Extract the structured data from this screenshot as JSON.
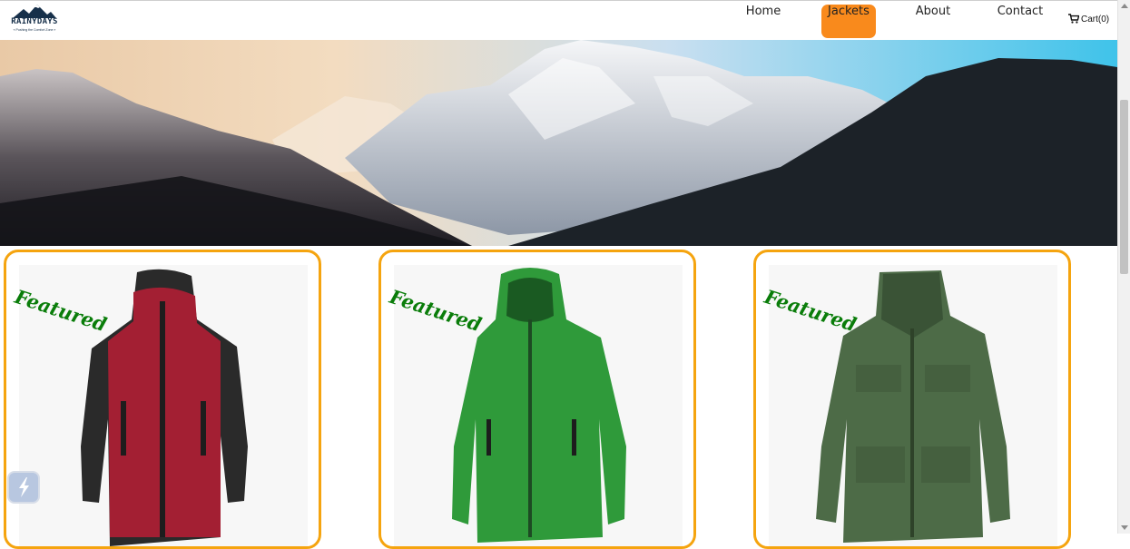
{
  "brand": {
    "name": "RAINYDAYS",
    "tagline": "« Pushing the Comfort Zone »"
  },
  "nav": {
    "items": [
      {
        "label": "Home",
        "active": false
      },
      {
        "label": "Jackets",
        "active": true
      },
      {
        "label": "About",
        "active": false
      },
      {
        "label": "Contact",
        "active": false
      }
    ],
    "cart_label": "Cart(0)",
    "cart_icon": "cart-icon"
  },
  "hero": {
    "image": "snowy-mountain-range-icon"
  },
  "products": [
    {
      "badge": "Featured",
      "jacket_color": "#a31f33",
      "sleeve_color": "#2a2a2a"
    },
    {
      "badge": "Featured",
      "jacket_color": "#2f9a3a",
      "sleeve_color": "#2f9a3a"
    },
    {
      "badge": "Featured",
      "jacket_color": "#4d6b47",
      "sleeve_color": "#4d6b47"
    }
  ],
  "colors": {
    "accent": "#f98a1c",
    "card_border": "#f5a40f",
    "featured_text": "#0a7d0a"
  },
  "widget": {
    "icon": "lightning-widget-icon"
  }
}
